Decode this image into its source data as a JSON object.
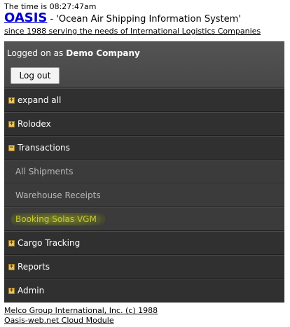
{
  "header": {
    "time_text": "The time is 08:27:47am",
    "brand": "OASIS",
    "separator": " - ",
    "tagline": "'Ocean Air Shipping Information System'",
    "since": "since 1988 serving the needs of International Logistics Companies"
  },
  "login": {
    "label": "Logged on as",
    "company": "Demo Company",
    "logout_label": "Log out"
  },
  "menu": {
    "items": [
      {
        "label": "expand all",
        "toggle": "+"
      },
      {
        "label": "Rolodex",
        "toggle": "+"
      },
      {
        "label": "Transactions",
        "toggle": "−"
      },
      {
        "label": "All Shipments"
      },
      {
        "label": "Warehouse Receipts"
      },
      {
        "label": "Booking Solas VGM"
      },
      {
        "label": "Cargo Tracking",
        "toggle": "+"
      },
      {
        "label": "Reports",
        "toggle": "+"
      },
      {
        "label": "Admin",
        "toggle": "+"
      }
    ]
  },
  "footer": {
    "copyright": "Melco Group International, Inc. (c) 1988",
    "module": "Oasis-web.net Cloud Module"
  },
  "colors": {
    "brand": "#0000cc",
    "menu_bg": "#303030",
    "highlight": "#c8c83a"
  }
}
